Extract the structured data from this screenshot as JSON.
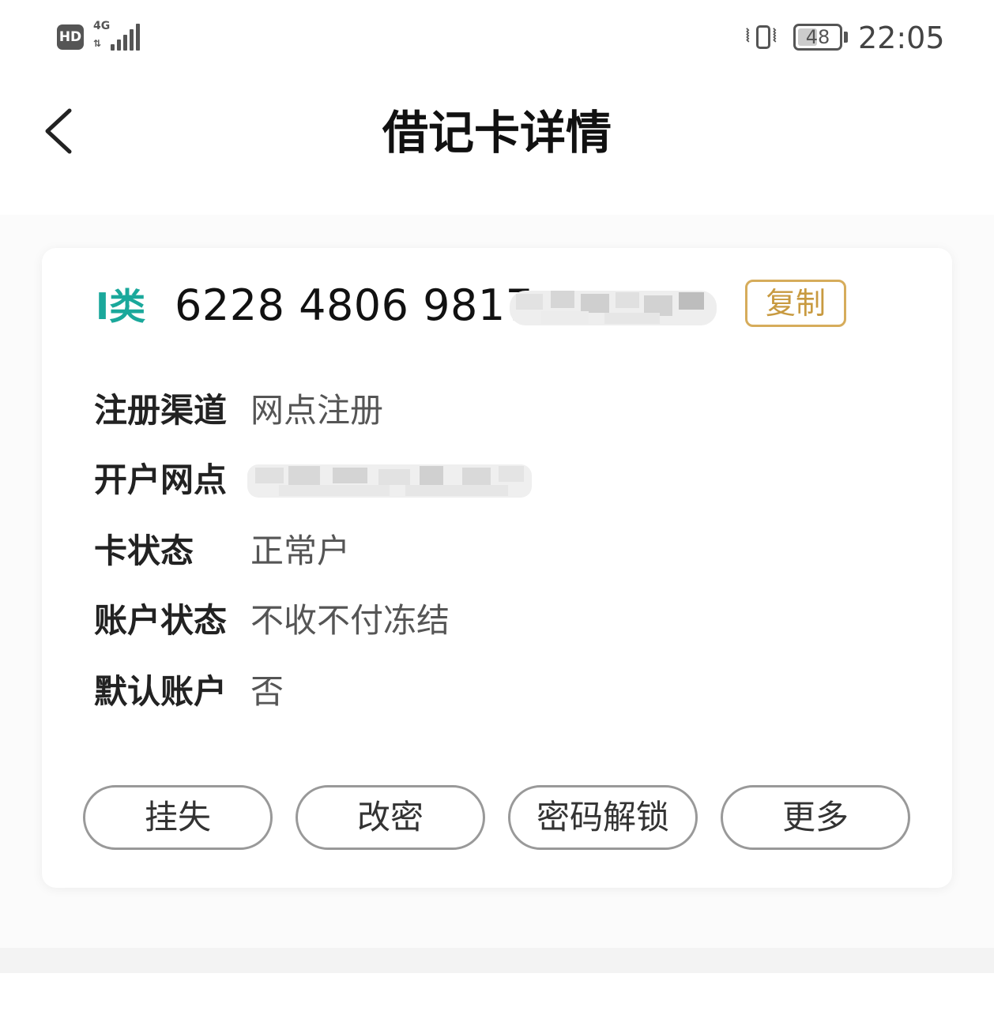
{
  "status_bar": {
    "hd": "HD",
    "network": "4G",
    "network_arrows": "⇅",
    "battery": "48",
    "battery_level": 0.48,
    "time": "22:05",
    "icons": [
      "hd-icon",
      "signal-icon",
      "vibrate-icon",
      "battery-icon"
    ]
  },
  "header": {
    "back_icon": "chevron-left-icon",
    "title": "借记卡详情"
  },
  "card": {
    "type_label": "I类",
    "number_visible": "6228 4806 9817",
    "copy_label": "复制",
    "accent_color": "#1aa89b",
    "copy_color": "#c89a40",
    "fields": [
      {
        "label": "注册渠道",
        "value": "网点注册"
      },
      {
        "label": "开户网点",
        "value": ""
      },
      {
        "label": "卡状态",
        "value": "正常户"
      },
      {
        "label": "账户状态",
        "value": "不收不付冻结"
      },
      {
        "label": "默认账户",
        "value": "否"
      }
    ],
    "actions": [
      {
        "label": "挂失"
      },
      {
        "label": "改密"
      },
      {
        "label": "密码解锁"
      },
      {
        "label": "更多"
      }
    ]
  }
}
